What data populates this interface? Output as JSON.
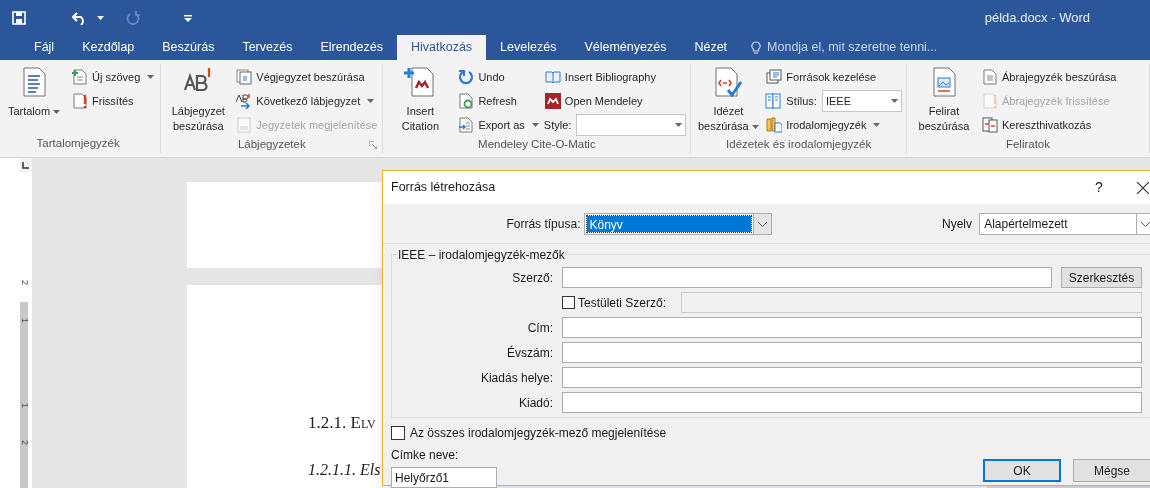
{
  "title_bar": {
    "quick_access": [
      {
        "kind": "save",
        "disabled": false
      },
      {
        "kind": "undo",
        "disabled": false
      },
      {
        "kind": "redo",
        "disabled": true
      },
      {
        "kind": "customize",
        "disabled": false
      }
    ],
    "title": "példa.docx - Word"
  },
  "tabs": [
    {
      "label": "Fájl",
      "selected": false
    },
    {
      "label": "Kezdőlap",
      "selected": false
    },
    {
      "label": "Beszúrás",
      "selected": false
    },
    {
      "label": "Tervezés",
      "selected": false
    },
    {
      "label": "Elrendezés",
      "selected": false
    },
    {
      "label": "Hivatkozás",
      "selected": true
    },
    {
      "label": "Levelezés",
      "selected": false
    },
    {
      "label": "Véleményezés",
      "selected": false
    },
    {
      "label": "Nézet",
      "selected": false
    }
  ],
  "tell_me": {
    "placeholder": "Mondja el, mit szeretne tenni..."
  },
  "ribbon": [
    {
      "label": "Tartalomjegyzék",
      "launcher": false,
      "columns": [
        {
          "kind": "large",
          "label": "Tartalom",
          "dropdown": true
        },
        {
          "kind": "stack",
          "items": [
            {
              "kind": "button",
              "label": "Új szöveg",
              "dropdown": true,
              "disabled": false
            },
            {
              "kind": "button",
              "label": "Frissítés",
              "dropdown": false,
              "disabled": false
            }
          ]
        }
      ]
    },
    {
      "label": "Lábjegyzetek",
      "launcher": true,
      "columns": [
        {
          "kind": "large",
          "label": "Lábjegyzet beszúrása",
          "dropdown": false
        },
        {
          "kind": "stack",
          "items": [
            {
              "kind": "button",
              "label": "Végjegyzet beszúrása",
              "dropdown": false,
              "disabled": false
            },
            {
              "kind": "button",
              "label": "Következő lábjegyzet",
              "dropdown": true,
              "disabled": false
            },
            {
              "kind": "button",
              "label": "Jegyzetek megjelenítése",
              "dropdown": false,
              "disabled": true
            }
          ]
        }
      ]
    },
    {
      "label": "Mendeley Cite-O-Matic",
      "launcher": false,
      "columns": [
        {
          "kind": "large",
          "label": "Insert Citation",
          "dropdown": false
        },
        {
          "kind": "stack",
          "items": [
            {
              "kind": "button",
              "label": "Undo",
              "dropdown": false,
              "disabled": false
            },
            {
              "kind": "button",
              "label": "Refresh",
              "dropdown": false,
              "disabled": false
            },
            {
              "kind": "button",
              "label": "Export as",
              "dropdown": true,
              "disabled": false
            }
          ]
        },
        {
          "kind": "stack",
          "items": [
            {
              "kind": "button",
              "label": "Insert Bibliography",
              "dropdown": false,
              "disabled": false
            },
            {
              "kind": "button",
              "label": "Open Mendeley",
              "dropdown": false,
              "disabled": false
            },
            {
              "kind": "combo",
              "label": "Style:"
            }
          ]
        }
      ]
    },
    {
      "label": "Idézetek és irodalomjegyzék",
      "launcher": false,
      "columns": [
        {
          "kind": "large",
          "label": "Idézet beszúrása",
          "dropdown": true
        },
        {
          "kind": "stack",
          "items": [
            {
              "kind": "button",
              "label": "Források kezelése",
              "dropdown": false,
              "disabled": false
            },
            {
              "kind": "combo",
              "label": "Stílus:",
              "value": "IEEE"
            },
            {
              "kind": "button",
              "label": "Irodalomjegyzék",
              "dropdown": true,
              "disabled": false
            }
          ]
        }
      ]
    },
    {
      "label": "Feliratok",
      "launcher": false,
      "columns": [
        {
          "kind": "large",
          "label": "Felirat beszúrása",
          "dropdown": false
        },
        {
          "kind": "stack",
          "items": [
            {
              "kind": "button",
              "label": "Ábrajegyzék beszúrása",
              "dropdown": false,
              "disabled": false
            },
            {
              "kind": "button",
              "label": "Ábrajegyzék frissítése",
              "dropdown": false,
              "disabled": true
            },
            {
              "kind": "button",
              "label": "Kereszthivatkozás",
              "dropdown": false,
              "disabled": false
            }
          ]
        }
      ]
    }
  ],
  "vertical_ruler": {
    "numbers": [
      "2",
      "1",
      "1",
      "2"
    ]
  },
  "document": {
    "headings": [
      {
        "kind": "section",
        "text": "1.2.1. Elv"
      },
      {
        "kind": "subsection",
        "text": "1.2.1.1. Els"
      }
    ]
  },
  "dialog": {
    "title": "Forrás létrehozása",
    "help": "?",
    "source_type": {
      "label": "Forrás típusa:",
      "value": "Könyv",
      "selected": true
    },
    "language": {
      "label": "Nyelv",
      "value": "Alapértelmezett"
    },
    "fieldset": {
      "legend": "IEEE – irodalomjegyzék-mezők",
      "fields": [
        {
          "kind": "text",
          "label": "Szerző:",
          "button": "Szerkesztés"
        },
        {
          "kind": "checkbox",
          "label": "Testületi Szerző:",
          "checked": false,
          "input_disabled": true
        },
        {
          "kind": "text",
          "label": "Cím:"
        },
        {
          "kind": "text",
          "label": "Évszám:"
        },
        {
          "kind": "text",
          "label": "Kiadás helye:"
        },
        {
          "kind": "text",
          "label": "Kiadó:"
        }
      ]
    },
    "show_all": {
      "label": "Az összes irodalomjegyzék-mező megjelenítése",
      "checked": false
    },
    "tag": {
      "label": "Címke neve:",
      "value": "Helyőrző1"
    },
    "buttons": [
      {
        "label": "OK",
        "default": true
      },
      {
        "label": "Mégse",
        "default": false
      }
    ]
  }
}
